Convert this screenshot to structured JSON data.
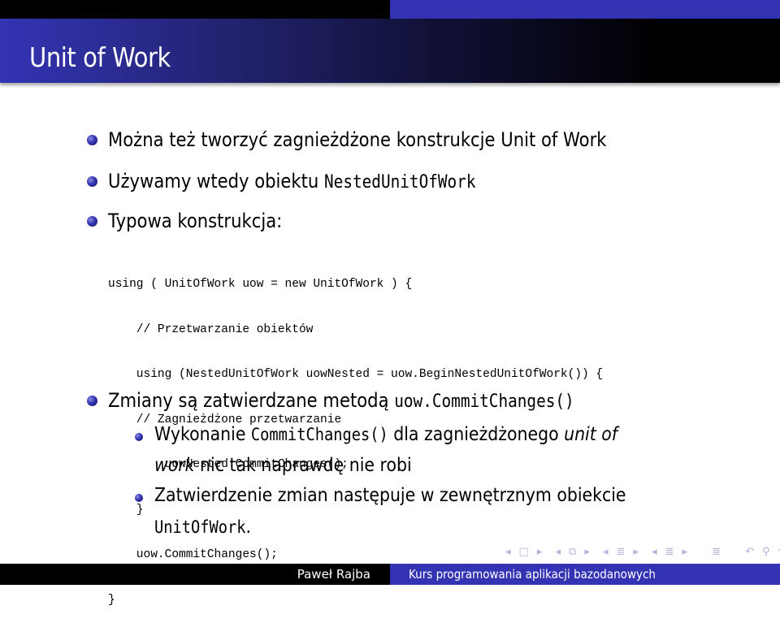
{
  "slide": {
    "title": "Unit of Work",
    "bullets": [
      {
        "text": "Można też tworzyć zagnieżdżone konstrukcje Unit of Work"
      },
      {
        "text": "Używamy wtedy obiektu ",
        "code": "NestedUnitOfWork"
      },
      {
        "text": "Typowa konstrukcja:"
      }
    ],
    "code_lines": [
      "using ( UnitOfWork uow = new UnitOfWork ) {",
      "    // Przetwarzanie obiektów",
      "    using (NestedUnitOfWork uowNested = uow.BeginNestedUnitOfWork()) {",
      "    // Zagnieżdżone przetwarzanie",
      "        uowNested.CommitChanges();",
      "    }",
      "    uow.CommitChanges();",
      "}"
    ],
    "bullet4": {
      "text": "Zmiany są zatwierdzane metodą ",
      "code": "uow.CommitChanges()"
    },
    "subbullets": [
      {
        "pre": "Wykonanie ",
        "code": "CommitChanges()",
        "mid": " dla zagnieżdżonego ",
        "italic1": "unit of",
        "italic2": "work",
        "post": " nic tak naprawdę nie robi"
      },
      {
        "text": "Zatwierdzenie zmian następuje w zewnętrznym obiekcie",
        "code": "UnitOfWork",
        "post": "."
      }
    ]
  },
  "navigation": {
    "icons": [
      "nav-prev-frame",
      "nav-frame",
      "nav-next-frame",
      "nav-prev-subsection",
      "nav-subsection",
      "nav-next-subsection",
      "nav-prev-section",
      "nav-section",
      "nav-next-section",
      "nav-toc",
      "nav-back",
      "nav-search",
      "nav-forward"
    ]
  },
  "footer": {
    "author": "Paweł Rajba",
    "course": "Kurs programowania aplikacji bazodanowych"
  },
  "colors": {
    "accent": "#3333b3",
    "title_bg_start": "#3434b5",
    "title_bg_end": "#000000"
  }
}
